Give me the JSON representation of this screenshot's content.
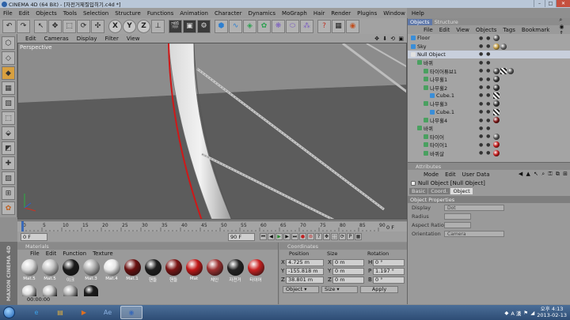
{
  "window": {
    "title": "CINEMA 4D (64 Bit) - [자전거제질입히기.c4d *]",
    "buttons": [
      "–",
      "□",
      "✕"
    ]
  },
  "menu": [
    "File",
    "Edit",
    "Objects",
    "Tools",
    "Selection",
    "Structure",
    "Functions",
    "Animation",
    "Character",
    "Dynamics",
    "MoGraph",
    "Hair",
    "Render",
    "Plugins",
    "Window",
    "Help"
  ],
  "viewport": {
    "menu": [
      "Edit",
      "Cameras",
      "Display",
      "Filter",
      "View"
    ],
    "label": "Perspective",
    "nav_icons": "✥ ⬇ ⟲ ▣"
  },
  "timeline": {
    "ticks": [
      "0",
      "5",
      "10",
      "15",
      "20",
      "25",
      "30",
      "35",
      "40",
      "45",
      "50",
      "55",
      "60",
      "65",
      "70",
      "75",
      "80",
      "85",
      "90"
    ],
    "end_label": "0 F"
  },
  "transport": {
    "start": "0 F",
    "current": "0 F",
    "end": "90 F"
  },
  "materials": {
    "panel_title": "Materials",
    "menu": [
      "File",
      "Edit",
      "Function",
      "Texture"
    ],
    "items": [
      {
        "label": "Mat.5",
        "color": "#d8d8d8"
      },
      {
        "label": "Mat.5",
        "color": "#c4c4c4"
      },
      {
        "label": "이크",
        "color": "#1a1a1a"
      },
      {
        "label": "Mat.3",
        "color": "#b0b0b0"
      },
      {
        "label": "Mat.4",
        "color": "#e6e6e6"
      },
      {
        "label": "Mat.1",
        "color": "#6a1010"
      },
      {
        "label": "핸들",
        "color": "#1e1e1e"
      },
      {
        "label": "핸들",
        "color": "#7a1414"
      },
      {
        "label": "Mat",
        "color": "#c01818"
      },
      {
        "label": "체인",
        "color": "#9c3030"
      },
      {
        "label": "자전거",
        "color": "#222222"
      },
      {
        "label": "타이어",
        "color": "#c82020"
      }
    ],
    "row2_colors": [
      "#e0e0e0",
      "#d0d0d0",
      "#b8b8b8",
      "#1c1c1c"
    ]
  },
  "status": "00:00:00",
  "brand": "MAXON CINEMA 4D",
  "coordinates": {
    "panel_title": "Coordinates",
    "columns": [
      "Position",
      "Size",
      "Rotation"
    ],
    "rows": [
      {
        "axis": "X",
        "position": "4.725 m",
        "size": "0 m",
        "rot_axis": "H",
        "rotation": "0 °"
      },
      {
        "axis": "Y",
        "position": "-155.818 m",
        "size": "0 m",
        "rot_axis": "P",
        "rotation": "1.197 °"
      },
      {
        "axis": "Z",
        "position": "38.801 m",
        "size": "0 m",
        "rot_axis": "B",
        "rotation": "0 °"
      }
    ],
    "mode": "Object",
    "size_mode": "Size",
    "apply": "Apply"
  },
  "objects_panel": {
    "tabs": [
      "Objects",
      "Structure"
    ],
    "menu": [
      "File",
      "Edit",
      "View",
      "Objects",
      "Tags",
      "Bookmark"
    ],
    "rows": [
      {
        "name": "Floor",
        "indent": 0,
        "icon": "#3a8ed8",
        "tags": [
          "#555555"
        ]
      },
      {
        "name": "Sky",
        "indent": 0,
        "icon": "#3a8ed8",
        "tags": [
          "#c09a40",
          "#666666"
        ]
      },
      {
        "name": "Null Object",
        "indent": 0,
        "icon": "#e0e0e0",
        "tags": [],
        "selected": true
      },
      {
        "name": "바퀴",
        "indent": 1,
        "icon": "#4aa060",
        "tags": []
      },
      {
        "name": "타이어튜브1",
        "indent": 2,
        "icon": "#4aa060",
        "tags": [
          "#444444",
          "chk",
          "#555555"
        ]
      },
      {
        "name": "나무휠1",
        "indent": 2,
        "icon": "#4aa060",
        "tags": [
          "#333333"
        ]
      },
      {
        "name": "나무휠2",
        "indent": 2,
        "icon": "#4aa060",
        "tags": [
          "#333333"
        ]
      },
      {
        "name": "Cube.1",
        "indent": 3,
        "icon": "#3a8ed8",
        "tags": [
          "chk"
        ]
      },
      {
        "name": "나무휠3",
        "indent": 2,
        "icon": "#4aa060",
        "tags": [
          "#333333"
        ]
      },
      {
        "name": "Cube.1",
        "indent": 3,
        "icon": "#3a8ed8",
        "tags": [
          "chk"
        ]
      },
      {
        "name": "나무휠4",
        "indent": 2,
        "icon": "#4aa060",
        "tags": [
          "#7a1414"
        ]
      },
      {
        "name": "바퀴",
        "indent": 1,
        "icon": "#4aa060",
        "tags": []
      },
      {
        "name": "타이어",
        "indent": 2,
        "icon": "#4aa060",
        "tags": [
          "#555555"
        ]
      },
      {
        "name": "타이어1",
        "indent": 2,
        "icon": "#4aa060",
        "tags": [
          "#c01818"
        ]
      },
      {
        "name": "바퀴살",
        "indent": 2,
        "icon": "#4aa060",
        "tags": [
          "#c01818"
        ]
      }
    ]
  },
  "attributes": {
    "panel_title": "Attributes",
    "menu": [
      "Mode",
      "Edit",
      "User Data"
    ],
    "object_title": "Null Object [Null Object]",
    "tabs": [
      "Basic",
      "Coord.",
      "Object"
    ],
    "active_tab": "Object",
    "section": "Object Properties",
    "props": [
      {
        "label": "Display",
        "value": "Dot"
      },
      {
        "label": "Radius",
        "value": ""
      },
      {
        "label": "Aspect Ratio",
        "value": ""
      },
      {
        "label": "Orientation",
        "value": "Camera"
      }
    ]
  },
  "taskbar": {
    "apps": [
      {
        "name": "ie",
        "glyph": "e",
        "color": "#3aa0e8"
      },
      {
        "name": "explorer",
        "glyph": "▤",
        "color": "#e0b040"
      },
      {
        "name": "media",
        "glyph": "▶",
        "color": "#e07020"
      },
      {
        "name": "aftereffects",
        "glyph": "Ae",
        "color": "#8ab0e0"
      },
      {
        "name": "cinema4d",
        "glyph": "◉",
        "color": "#3a6ab8"
      }
    ],
    "lang": "A 漢",
    "time": "오후 4:13",
    "date": "2013-02-13"
  }
}
